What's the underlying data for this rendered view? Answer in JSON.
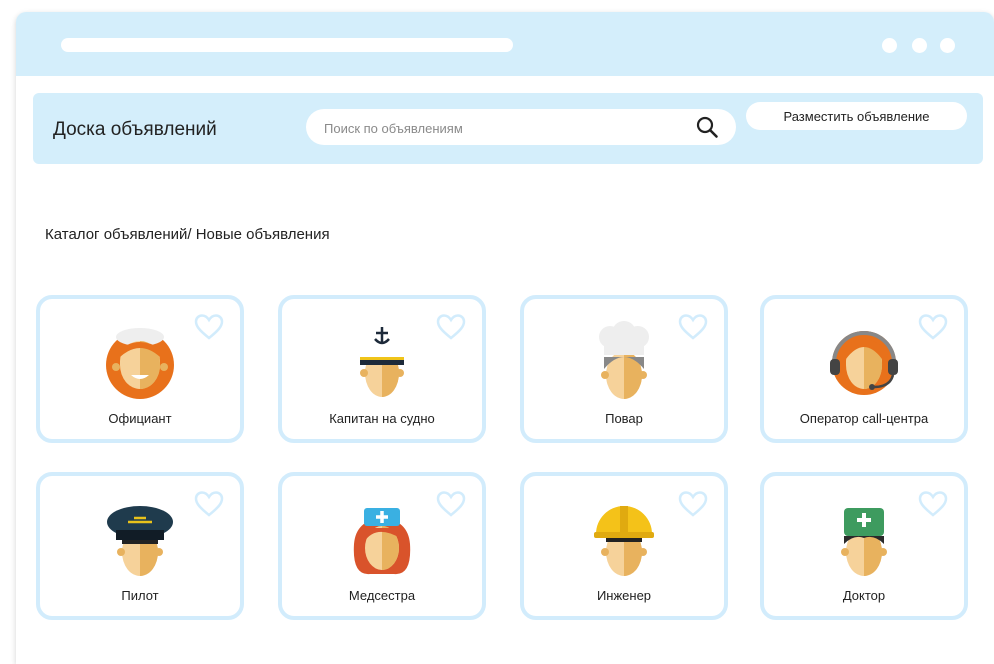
{
  "header": {
    "site_title": "Доска объявлений",
    "search_placeholder": "Поиск по объявлениям",
    "post_button": "Разместить объявление"
  },
  "breadcrumb": "Каталог объявлений/ Новые объявления",
  "cards": [
    {
      "label": "Официант",
      "avatar": "waitress-icon"
    },
    {
      "label": "Капитан на судно",
      "avatar": "captain-icon"
    },
    {
      "label": "Повар",
      "avatar": "chef-icon"
    },
    {
      "label": "Оператор call-центра",
      "avatar": "call-center-operator-icon"
    },
    {
      "label": "Пилот",
      "avatar": "pilot-icon"
    },
    {
      "label": "Медсестра",
      "avatar": "nurse-icon"
    },
    {
      "label": "Инженер",
      "avatar": "engineer-icon"
    },
    {
      "label": "Доктор",
      "avatar": "doctor-icon"
    }
  ],
  "colors": {
    "accent_light_blue": "#d4eefb",
    "card_border": "#d2ecfc",
    "skin_light": "#f6d29a",
    "skin_shade": "#e8b25e"
  }
}
